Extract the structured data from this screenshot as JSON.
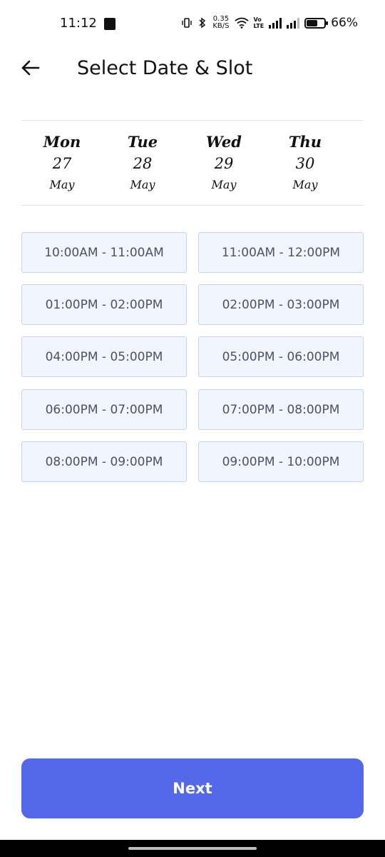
{
  "status_bar": {
    "time": "11:12",
    "net_speed_value": "0.35",
    "net_speed_unit": "KB/S",
    "volte_top": "Vo",
    "volte_bottom": "LTE",
    "battery_percent": "66%",
    "battery_level": 0.66,
    "icons": [
      "notification-app-icon",
      "vibrate-icon",
      "bluetooth-icon",
      "wifi-icon",
      "signal-icon",
      "battery-icon"
    ]
  },
  "header": {
    "title": "Select Date & Slot",
    "back_icon": "arrow-left-icon"
  },
  "dates": [
    {
      "day": "Mon",
      "date": "27",
      "month": "May"
    },
    {
      "day": "Tue",
      "date": "28",
      "month": "May"
    },
    {
      "day": "Wed",
      "date": "29",
      "month": "May"
    },
    {
      "day": "Thu",
      "date": "30",
      "month": "May"
    }
  ],
  "slots": [
    "10:00AM - 11:00AM",
    "11:00AM - 12:00PM",
    "01:00PM - 02:00PM",
    "02:00PM - 03:00PM",
    "04:00PM - 05:00PM",
    "05:00PM - 06:00PM",
    "06:00PM - 07:00PM",
    "07:00PM - 08:00PM",
    "08:00PM - 09:00PM",
    "09:00PM - 10:00PM"
  ],
  "next_button": {
    "label": "Next"
  },
  "colors": {
    "primary": "#5469ea",
    "slot_bg": "#f1f5fd",
    "slot_border": "#c6d2ee",
    "slot_text": "#4a5264"
  }
}
